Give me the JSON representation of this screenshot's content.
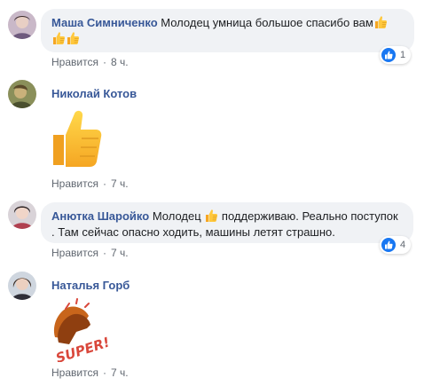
{
  "comments": [
    {
      "author": "Маша Симниченко",
      "text_part1": "Молодец умница большое спасибо вам",
      "like_label": "Нравится",
      "time": "8 ч.",
      "reaction_count": "1",
      "emoji": "thumbs-up-emoji"
    },
    {
      "author": "Николай Котов",
      "like_label": "Нравится",
      "time": "7 ч.",
      "sticker": "thumbs-up-sticker"
    },
    {
      "author": "Анютка Шаройко",
      "text_part1": "Молодец",
      "text_part2": "поддерживаю. Реально поступок",
      "text_line2": ". Там сейчас опасно ходить, машины летят страшно.",
      "like_label": "Нравится",
      "time": "7 ч.",
      "reaction_count": "4",
      "emoji": "thumbs-up-emoji"
    },
    {
      "author": "Наталья Горб",
      "like_label": "Нравится",
      "time": "7 ч.",
      "sticker": "super-clapping-sticker",
      "sticker_text": "SUPER!"
    }
  ],
  "colors": {
    "author": "#385898",
    "bubble": "#f0f2f5",
    "meta": "#606770",
    "like_badge": "#1877f2"
  }
}
